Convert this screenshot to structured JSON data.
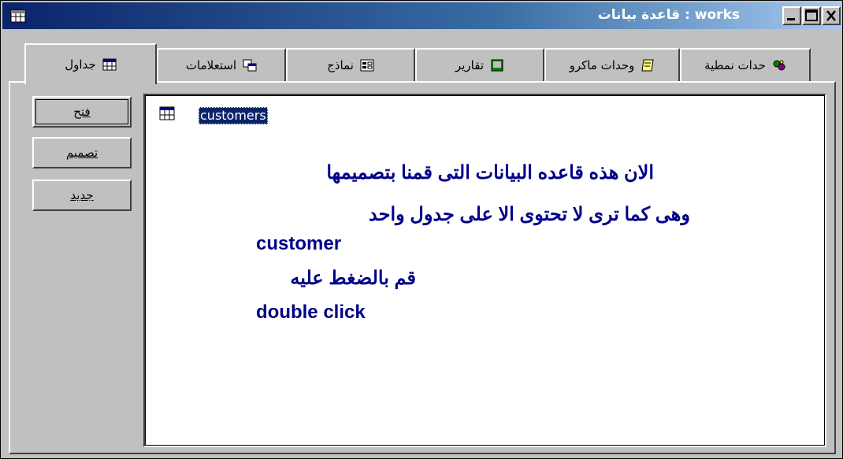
{
  "window": {
    "title": "works : قاعدة بيانات",
    "colors": {
      "titlebar_start": "#0a246a",
      "titlebar_end": "#a6caf0",
      "face": "#c0c0c0",
      "annotation": "#000088",
      "selection": "#0a246a"
    },
    "icons": {
      "app": "database-window-icon",
      "minimize": "minimize-icon",
      "maximize": "maximize-icon",
      "close": "close-icon"
    }
  },
  "tabs": [
    {
      "label": "جداول",
      "icon": "table-icon",
      "active": true
    },
    {
      "label": "استعلامات",
      "icon": "query-icon"
    },
    {
      "label": "نماذج",
      "icon": "form-icon"
    },
    {
      "label": "تقارير",
      "icon": "report-icon"
    },
    {
      "label": "وحدات ماكرو",
      "icon": "macro-icon"
    },
    {
      "label": "حدات نمطية",
      "icon": "module-icon"
    }
  ],
  "side_buttons": {
    "open": "فتح",
    "design": "تصميم",
    "new": "جديد"
  },
  "list": {
    "items": [
      {
        "label": "customers",
        "icon": "table-icon",
        "selected": true
      }
    ]
  },
  "annotation": {
    "line1": "الان هذه قاعده البيانات التى قمنا بتصميمها",
    "line2": "وهى كما ترى لا تحتوى الا على جدول واحد",
    "line3": "customer",
    "line4": "قم بالضغط عليه",
    "line5": "double click"
  }
}
